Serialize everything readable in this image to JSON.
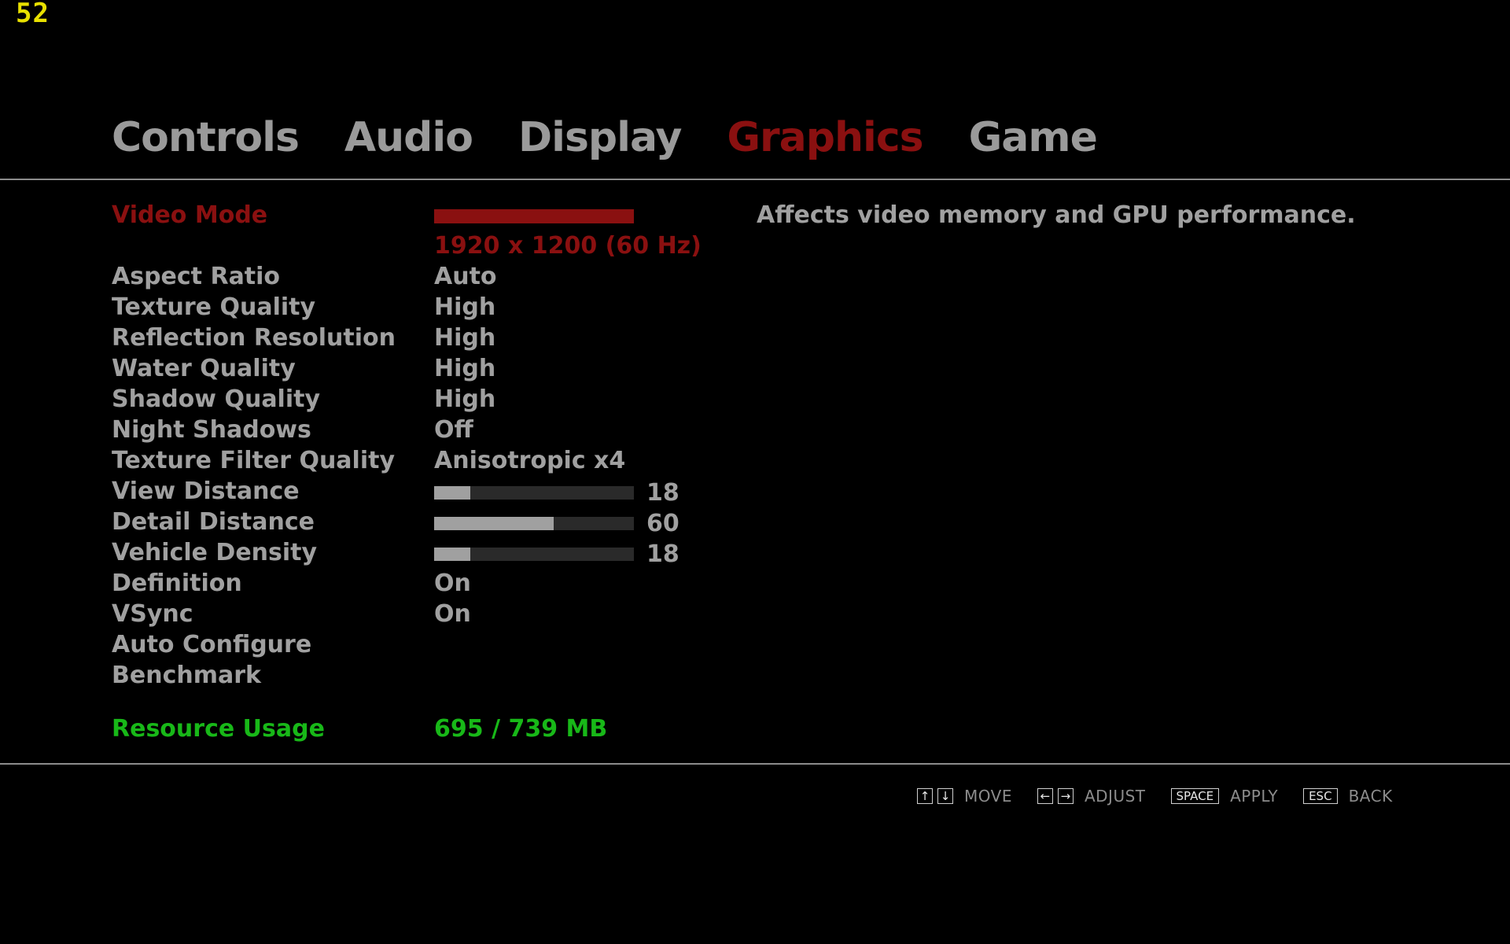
{
  "fps": "52",
  "tabs": [
    {
      "label": "Controls"
    },
    {
      "label": "Audio"
    },
    {
      "label": "Display"
    },
    {
      "label": "Graphics",
      "active": true
    },
    {
      "label": "Game"
    }
  ],
  "settings": {
    "video_mode": {
      "label": "Video Mode",
      "value": "1920 x 1200 (60 Hz)"
    },
    "aspect_ratio": {
      "label": "Aspect Ratio",
      "value": "Auto"
    },
    "texture_quality": {
      "label": "Texture Quality",
      "value": "High"
    },
    "reflection_resolution": {
      "label": "Reflection Resolution",
      "value": "High"
    },
    "water_quality": {
      "label": "Water Quality",
      "value": "High"
    },
    "shadow_quality": {
      "label": "Shadow Quality",
      "value": "High"
    },
    "night_shadows": {
      "label": "Night Shadows",
      "value": "Off"
    },
    "texture_filter_quality": {
      "label": "Texture Filter Quality",
      "value": "Anisotropic x4"
    },
    "view_distance": {
      "label": "View Distance",
      "value": "18",
      "fill_fraction": 0.18
    },
    "detail_distance": {
      "label": "Detail Distance",
      "value": "60",
      "fill_fraction": 0.6
    },
    "vehicle_density": {
      "label": "Vehicle Density",
      "value": "18",
      "fill_fraction": 0.18
    },
    "definition": {
      "label": "Definition",
      "value": "On"
    },
    "vsync": {
      "label": "VSync",
      "value": "On"
    },
    "auto_configure": {
      "label": "Auto Configure"
    },
    "benchmark": {
      "label": "Benchmark"
    },
    "resource_usage": {
      "label": "Resource Usage",
      "value": "695 / 739 MB"
    }
  },
  "description": "Affects video memory and GPU performance.",
  "footer": {
    "move_keys": [
      "↑",
      "↓"
    ],
    "move_label": "MOVE",
    "adjust_keys": [
      "←",
      "→"
    ],
    "adjust_label": "ADJUST",
    "apply_key": "SPACE",
    "apply_label": "APPLY",
    "back_key": "ESC",
    "back_label": "BACK"
  },
  "colors": {
    "active": "#8a1010",
    "inactive": "#a0a0a0",
    "resource": "#18b818",
    "fps": "#e8e000"
  }
}
